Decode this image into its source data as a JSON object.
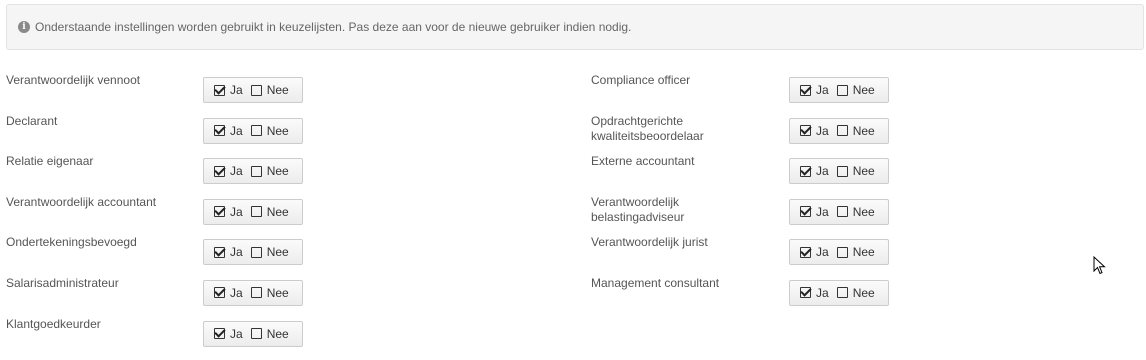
{
  "info": {
    "icon": "info-circle-icon",
    "text": "Onderstaande instellingen worden gebruikt in keuzelijsten. Pas deze aan voor de nieuwe gebruiker indien nodig."
  },
  "options": {
    "yes_label": "Ja",
    "no_label": "Nee"
  },
  "left_roles": [
    {
      "label": "Verantwoordelijk vennoot",
      "yes_checked": true,
      "no_checked": false
    },
    {
      "label": "Declarant",
      "yes_checked": true,
      "no_checked": false
    },
    {
      "label": "Relatie eigenaar",
      "yes_checked": true,
      "no_checked": false
    },
    {
      "label": "Verantwoordelijk accountant",
      "yes_checked": true,
      "no_checked": false
    },
    {
      "label": "Ondertekeningsbevoegd",
      "yes_checked": true,
      "no_checked": false
    },
    {
      "label": "Salarisadministrateur",
      "yes_checked": true,
      "no_checked": false
    },
    {
      "label": "Klantgoedkeurder",
      "yes_checked": true,
      "no_checked": false
    }
  ],
  "right_roles": [
    {
      "label": "Compliance officer",
      "yes_checked": true,
      "no_checked": false
    },
    {
      "label": "Opdrachtgerichte kwaliteitsbeoordelaar",
      "yes_checked": true,
      "no_checked": false
    },
    {
      "label": "Externe accountant",
      "yes_checked": true,
      "no_checked": false
    },
    {
      "label": "Verantwoordelijk belastingadviseur",
      "yes_checked": true,
      "no_checked": false
    },
    {
      "label": "Verantwoordelijk jurist",
      "yes_checked": true,
      "no_checked": false
    },
    {
      "label": "Management consultant",
      "yes_checked": true,
      "no_checked": false
    }
  ]
}
